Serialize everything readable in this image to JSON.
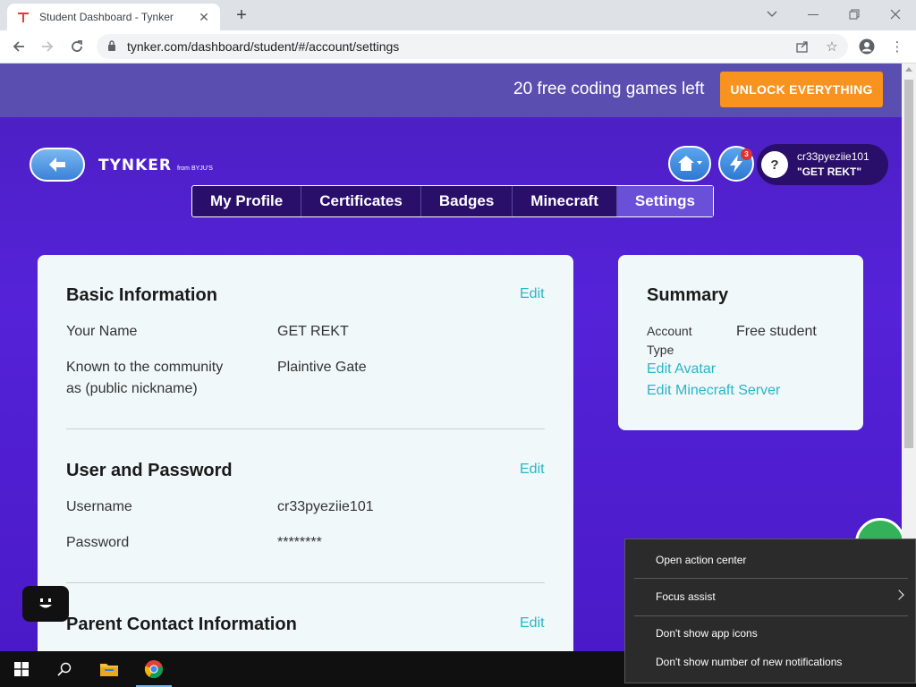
{
  "browser": {
    "tab_title": "Student Dashboard - Tynker",
    "url": "tynker.com/dashboard/student/#/account/settings"
  },
  "promo": {
    "text": "20 free coding games left",
    "unlock_label": "UNLOCK EVERYTHING"
  },
  "header": {
    "logo_brand": "TYNKER",
    "logo_from": "from BYJU'S",
    "notification_count": "3",
    "username": "cr33pyeziie101",
    "nickname": "\"GET REKT\"",
    "avatar_glyph": "?"
  },
  "nav": {
    "tabs": [
      {
        "label": "My Profile"
      },
      {
        "label": "Certificates"
      },
      {
        "label": "Badges"
      },
      {
        "label": "Minecraft"
      },
      {
        "label": "Settings"
      }
    ],
    "active": "Settings"
  },
  "basic_info": {
    "title": "Basic Information",
    "edit_label": "Edit",
    "name_label": "Your Name",
    "name_value": "GET REKT",
    "nickname_label_line1": "Known to the community",
    "nickname_label_line2": "as (public nickname)",
    "nickname_value": "Plaintive Gate"
  },
  "user_password": {
    "title": "User and Password",
    "edit_label": "Edit",
    "username_label": "Username",
    "username_value": "cr33pyeziie101",
    "password_label": "Password",
    "password_value": "********"
  },
  "parent_contact": {
    "title": "Parent Contact Information",
    "edit_label": "Edit"
  },
  "summary": {
    "title": "Summary",
    "account_type_label_line1": "Account",
    "account_type_label_line2": "Type",
    "account_type_value": "Free student",
    "edit_avatar": "Edit Avatar",
    "edit_minecraft": "Edit Minecraft Server"
  },
  "context_menu": {
    "items": [
      {
        "label": "Open action center"
      },
      {
        "label": "Focus assist"
      },
      {
        "label": "Don't show app icons"
      },
      {
        "label": "Don't show number of new notifications"
      }
    ]
  },
  "colors": {
    "accent_teal": "#2ab5c8",
    "unlock_orange": "#f7931e",
    "page_purple": "#5522d8"
  }
}
